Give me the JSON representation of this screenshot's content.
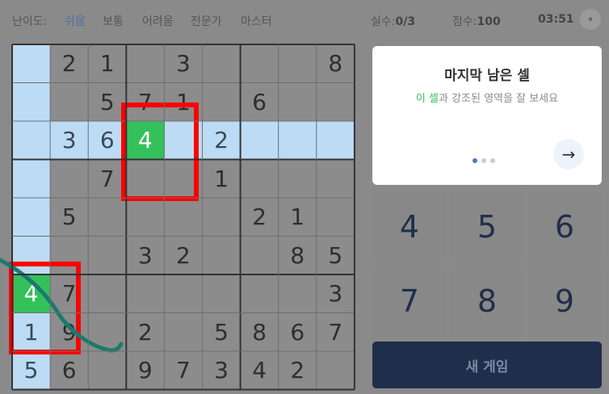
{
  "header": {
    "difficulty_label": "난이도:",
    "levels": [
      "쉬움",
      "보통",
      "어려움",
      "전문가",
      "마스터"
    ],
    "active_level": "쉬움",
    "mistakes_label": "실수:",
    "mistakes_value": "0/3",
    "score_label": "점수:",
    "score_value": "100",
    "timer": "03:51",
    "pause_symbol": "⏸"
  },
  "board": {
    "grid": [
      [
        "",
        "2",
        "1",
        "",
        "3",
        "",
        "",
        "",
        "8"
      ],
      [
        "",
        "",
        "5",
        "7",
        "1",
        "",
        "6",
        "",
        ""
      ],
      [
        "",
        "3",
        "6",
        "4",
        "",
        "2",
        "",
        "",
        ""
      ],
      [
        "",
        "",
        "7",
        "",
        "",
        "1",
        "",
        "",
        ""
      ],
      [
        "",
        "5",
        "",
        "",
        "",
        "",
        "2",
        "1",
        ""
      ],
      [
        "",
        "",
        "",
        "3",
        "2",
        "",
        "",
        "8",
        "5"
      ],
      [
        "4",
        "7",
        "",
        "",
        "",
        "",
        "",
        "",
        "3"
      ],
      [
        "1",
        "9",
        "",
        "2",
        "",
        "5",
        "8",
        "6",
        "7"
      ],
      [
        "5",
        "6",
        "",
        "9",
        "7",
        "3",
        "4",
        "2",
        ""
      ]
    ],
    "highlight_row": 2,
    "highlight_col": 0,
    "selected_cells": [
      [
        2,
        3
      ],
      [
        6,
        0
      ]
    ],
    "colors": {
      "cell": "#8c8c8c",
      "highlight": "#bcdcf5",
      "selected": "#34c15b",
      "annotation": "#ff0000"
    }
  },
  "hint": {
    "title": "마지막 남은 셀",
    "subtitle_highlight": "이 셀",
    "subtitle_rest": "과 강조된 영역을 잘 보세요",
    "next_icon": "arrow-right-icon",
    "next_symbol": "→",
    "pages": 3,
    "current_page": 0
  },
  "numpad": [
    "4",
    "5",
    "6",
    "7",
    "8",
    "9"
  ],
  "new_game_label": "새 게임"
}
